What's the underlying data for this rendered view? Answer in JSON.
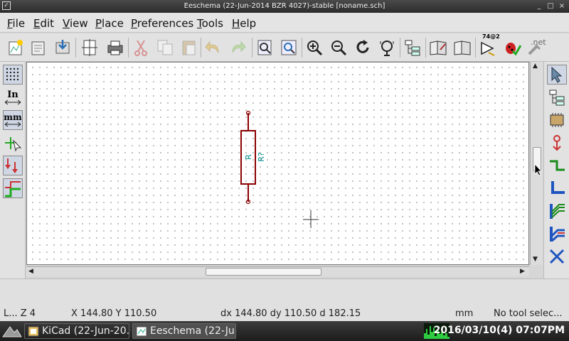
{
  "window": {
    "title": "Eeschema (22-Jun-2014 BZR 4027)-stable [noname.sch]",
    "controls": [
      "_",
      "□",
      "×"
    ]
  },
  "menubar": {
    "items": [
      {
        "accel": "F",
        "rest": "ile"
      },
      {
        "accel": "E",
        "rest": "dit"
      },
      {
        "accel": "V",
        "rest": "iew"
      },
      {
        "accel": "P",
        "rest": "lace"
      },
      {
        "accel": "P",
        "rest": "references"
      },
      {
        "accel": "T",
        "rest": "ools"
      },
      {
        "accel": "H",
        "rest": "elp"
      }
    ]
  },
  "toolbar": {
    "netlist_badge": ".net",
    "chip_badge": "74@2"
  },
  "lefttools": {
    "units_inch": "In",
    "units_mm": "mm"
  },
  "schematic": {
    "component_ref": "R?",
    "component_value": "R"
  },
  "statusbar": {
    "zoom": "L... Z 4",
    "abs_coords": "X 144.80  Y 110.50",
    "rel_coords": "dx 144.80  dy 110.50  d 182.15",
    "units": "mm",
    "tool": "No tool selec..."
  },
  "taskbar": {
    "tasks": [
      {
        "label": "KiCad (22-Jun-20..."
      },
      {
        "label": "Eeschema (22-Ju..."
      }
    ],
    "clock": "2016/03/10(4) 07:07PM"
  }
}
